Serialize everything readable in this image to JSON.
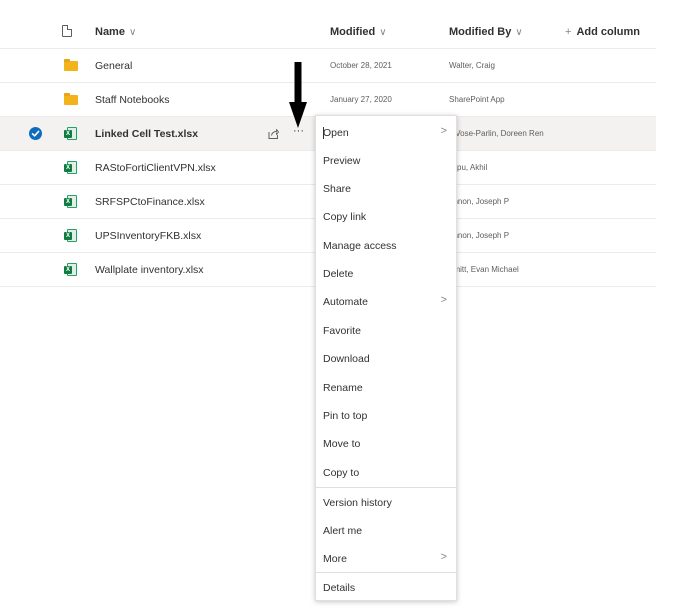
{
  "header": {
    "name": "Name",
    "name_chevron": "∨",
    "modified": "Modified",
    "modified_chevron": "∨",
    "modified_by": "Modified By",
    "modified_by_chevron": "∨",
    "add_plus": "+",
    "add_column": "Add column"
  },
  "rows": [
    {
      "name": "General",
      "modified": "October 28, 2021",
      "modified_by": "Walter, Craig",
      "type": "folder"
    },
    {
      "name": "Staff Notebooks",
      "modified": "January 27, 2020",
      "modified_by": "SharePoint App",
      "type": "folder"
    },
    {
      "name": "Linked Cell Test.xlsx",
      "modified": "",
      "modified_by": "elVose-Parlin, Doreen Ren",
      "type": "xlsx",
      "selected": true
    },
    {
      "name": "RAStoFortiClientVPN.xlsx",
      "modified": "",
      "modified_by": "llepu, Akhil",
      "type": "xlsx"
    },
    {
      "name": "SRFSPCtoFinance.xlsx",
      "modified": "",
      "modified_by": "annon, Joseph P",
      "type": "xlsx"
    },
    {
      "name": "UPSInventoryFKB.xlsx",
      "modified": "",
      "modified_by": "annon, Joseph P",
      "type": "xlsx"
    },
    {
      "name": "Wallplate inventory.xlsx",
      "modified": "",
      "modified_by": "hmitt, Evan Michael",
      "type": "xlsx"
    }
  ],
  "row_actions": {
    "more": "···",
    "xls_letter": "X"
  },
  "menu": {
    "items": [
      {
        "label": "Open",
        "submenu": ">"
      },
      {
        "label": "Preview"
      },
      {
        "label": "Share"
      },
      {
        "label": "Copy link"
      },
      {
        "label": "Manage access"
      },
      {
        "label": "Delete"
      },
      {
        "label": "Automate",
        "submenu": ">"
      },
      {
        "label": "Favorite"
      },
      {
        "label": "Download"
      },
      {
        "label": "Rename"
      },
      {
        "label": "Pin to top"
      },
      {
        "label": "Move to"
      },
      {
        "label": "Copy to"
      },
      {
        "label": "Version history"
      },
      {
        "label": "Alert me"
      },
      {
        "label": "More",
        "submenu": ">"
      },
      {
        "label": "Details"
      }
    ]
  },
  "icons": {
    "file_type": "document-icon",
    "folder": "folder-icon",
    "excel": "excel-file-icon",
    "selected": "checkmark-circle-icon",
    "share": "share-icon",
    "more": "more-options-icon",
    "annotation": "down-arrow-annotation"
  },
  "colors": {
    "accent": "#0f6cbd",
    "folder": "#f3b31b",
    "excel": "#107c41",
    "selected_row": "#f3f2f1"
  }
}
